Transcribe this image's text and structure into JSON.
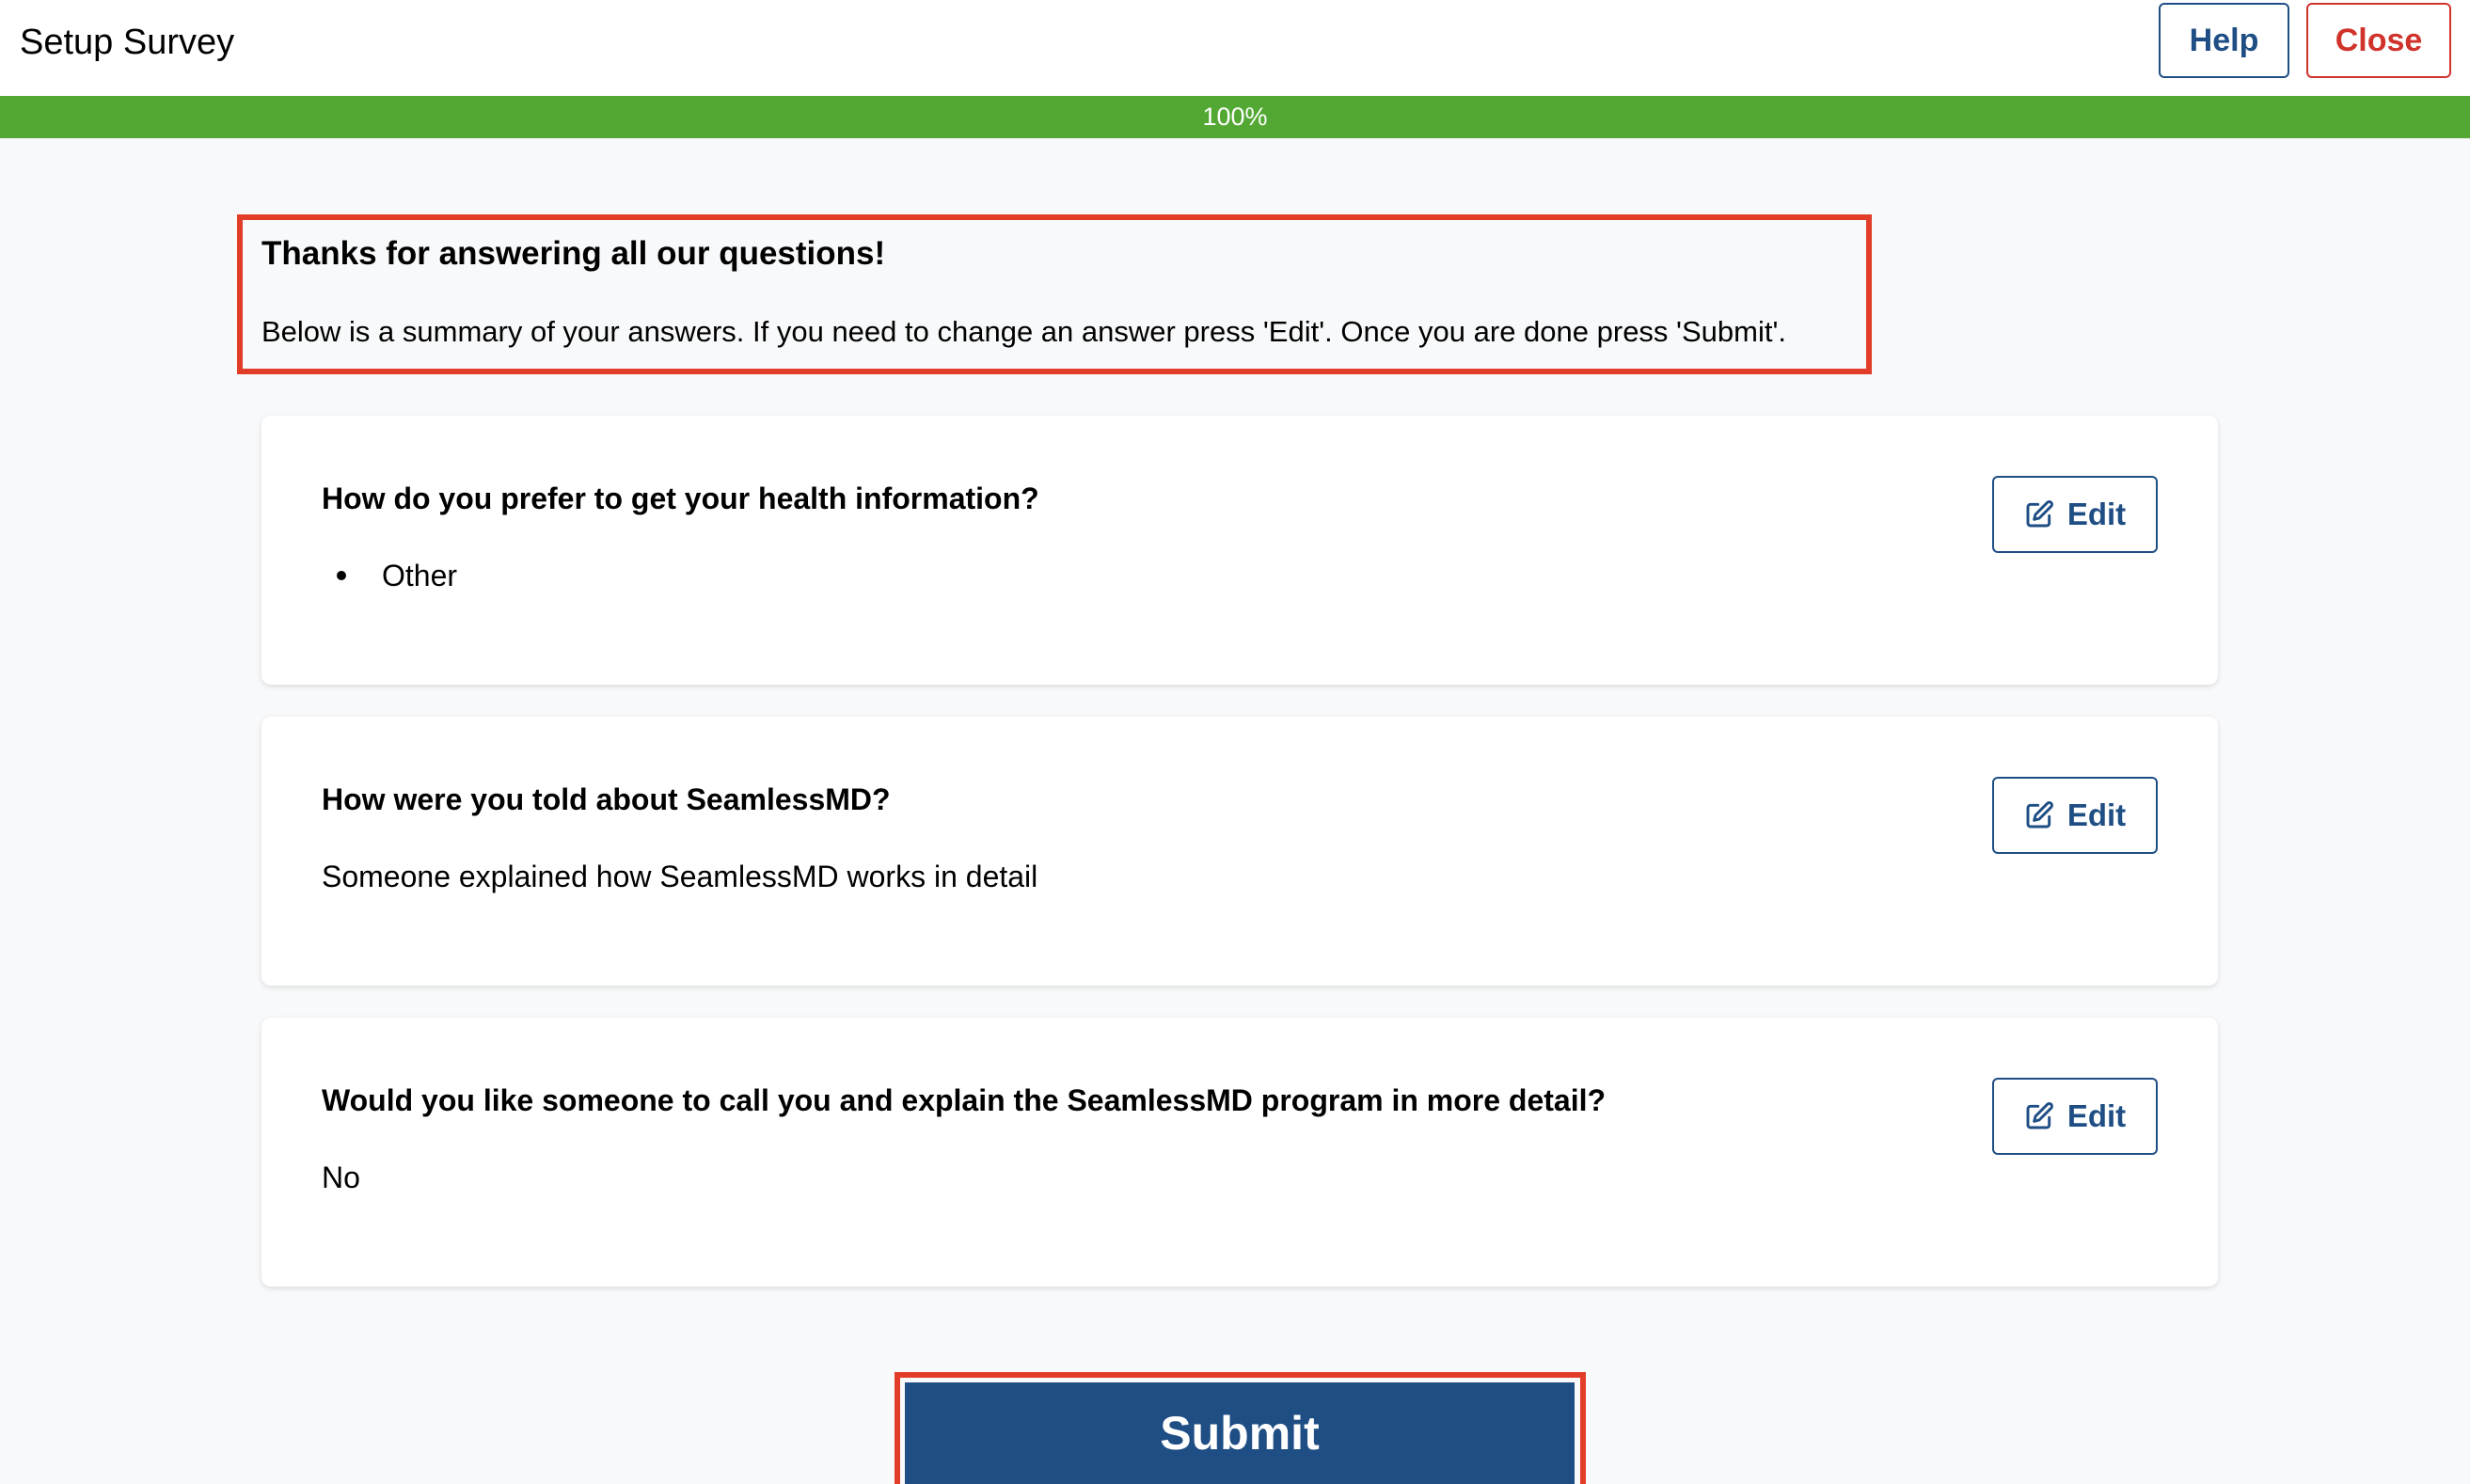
{
  "header": {
    "title": "Setup Survey",
    "help_label": "Help",
    "close_label": "Close"
  },
  "progress": {
    "percent": 100,
    "label": "100%"
  },
  "intro": {
    "title": "Thanks for answering all our questions!",
    "text": "Below is a summary of your answers. If you need to change an answer press 'Edit'. Once you are done press 'Submit'."
  },
  "cards": [
    {
      "question": "How do you prefer to get your health information?",
      "answer_list": [
        "Other"
      ],
      "edit_label": "Edit"
    },
    {
      "question": "How were you told about SeamlessMD?",
      "answer": "Someone explained how SeamlessMD works in detail",
      "edit_label": "Edit"
    },
    {
      "question": "Would you like someone to call you and explain the SeamlessMD program in more detail?",
      "answer": "No",
      "edit_label": "Edit"
    }
  ],
  "submit_label": "Submit",
  "colors": {
    "primary": "#1f4e85",
    "danger": "#d0332b",
    "progress": "#52a832",
    "highlight": "#e23d28"
  }
}
